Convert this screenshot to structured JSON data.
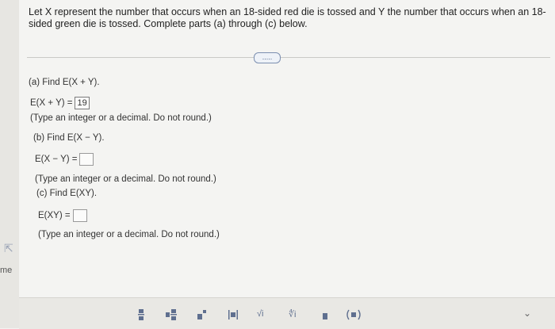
{
  "question": {
    "text": "Let X represent the number that occurs when an 18-sided red die is tossed and Y the number that occurs when an 18-sided green die is tossed. Complete parts (a) through (c) below."
  },
  "more_button": {
    "label": "....."
  },
  "parts": {
    "a": {
      "prompt": "(a) Find E(X + Y).",
      "lhs": "E(X + Y) =",
      "value": "19",
      "note": "(Type an integer or a decimal. Do not round.)"
    },
    "b": {
      "prompt": "(b) Find E(X − Y).",
      "lhs": "E(X − Y) =",
      "value": "",
      "note": "(Type an integer or a decimal. Do not round.)"
    },
    "c": {
      "prompt": "(c) Find E(XY).",
      "lhs": "E(XY) =",
      "value": "",
      "note": "(Type an integer or a decimal. Do not round.)"
    }
  },
  "side": {
    "label": "me"
  },
  "toolbar": {
    "icons": [
      "fraction-icon",
      "mixed-number-icon",
      "superscript-icon",
      "absolute-value-icon",
      "sqrt-icon",
      "nth-root-icon",
      "decimal-icon",
      "parentheses-icon",
      "more-chevron-icon"
    ],
    "sqrt_label": "√i",
    "nroot_label": "∜i",
    "chevron_label": "⌄"
  }
}
